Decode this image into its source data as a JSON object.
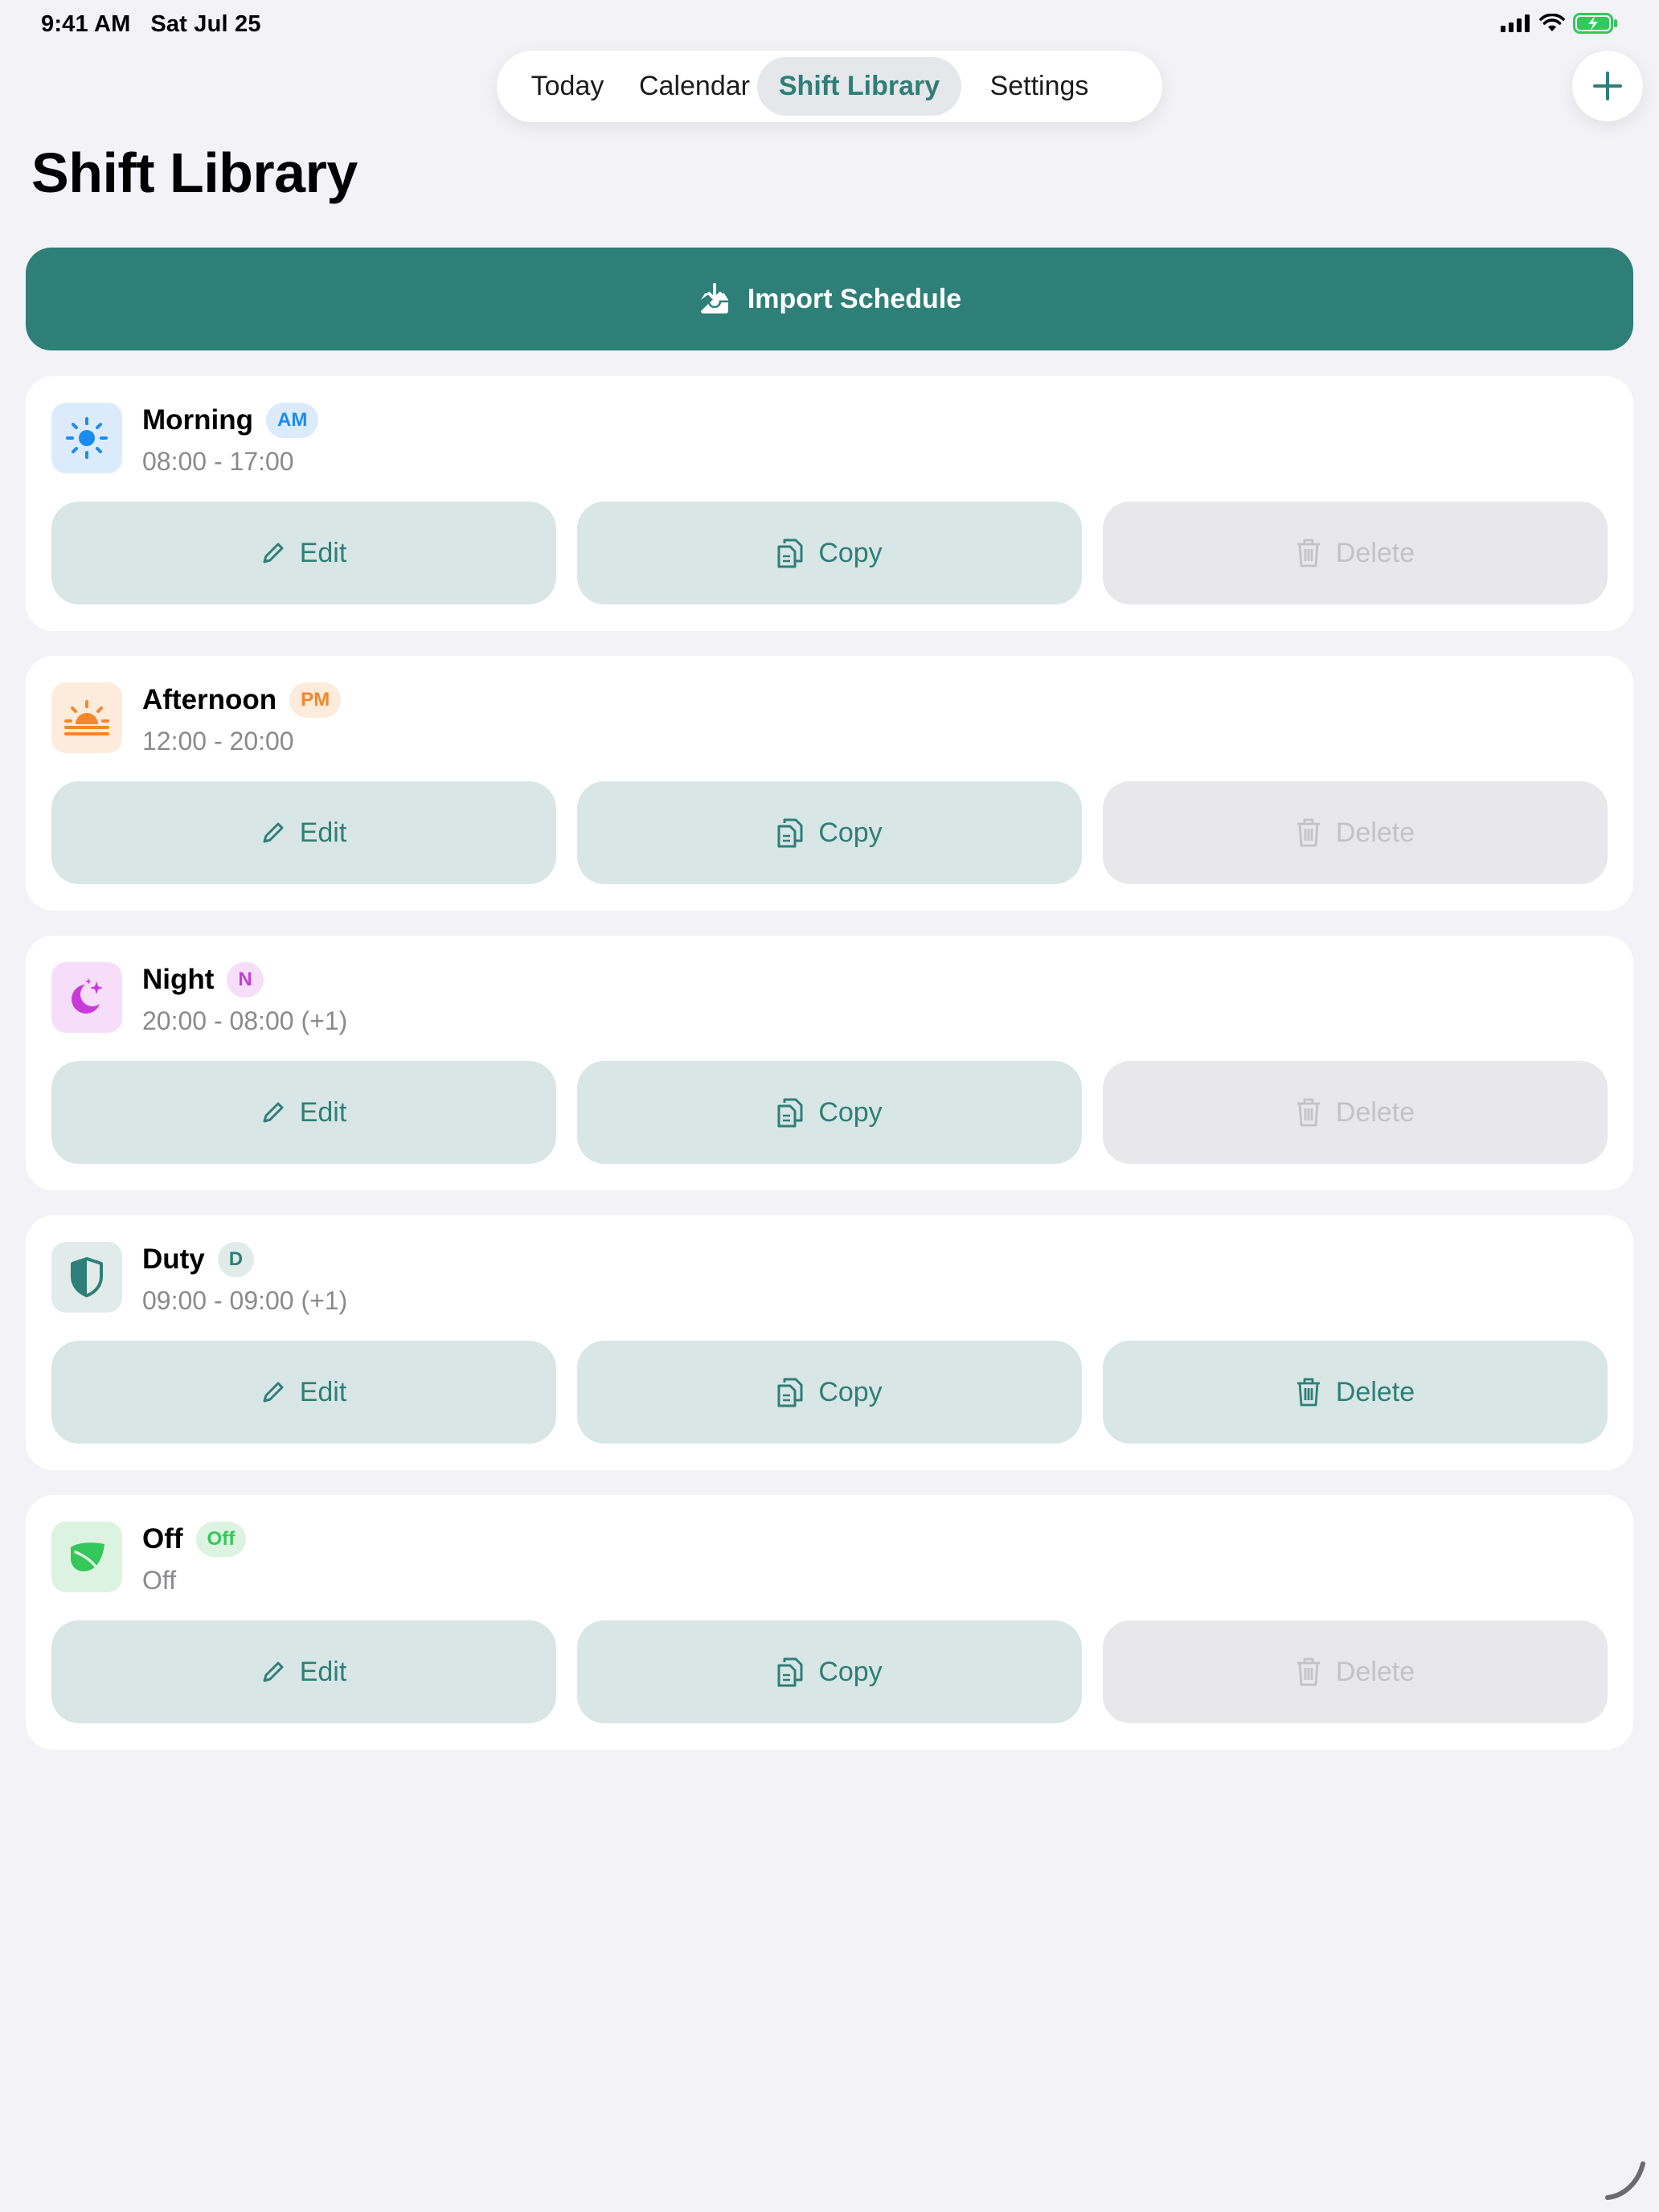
{
  "status_bar": {
    "time": "9:41 AM",
    "date": "Sat Jul 25"
  },
  "tabs": [
    {
      "label": "Today",
      "active": false
    },
    {
      "label": "Calendar",
      "active": false
    },
    {
      "label": "Shift Library",
      "active": true
    },
    {
      "label": "Settings",
      "active": false
    }
  ],
  "add_icon": "plus-icon",
  "page_title": "Shift Library",
  "import_button": {
    "label": "Import Schedule",
    "icon": "tray-download-icon"
  },
  "actions": {
    "edit": "Edit",
    "copy": "Copy",
    "delete": "Delete"
  },
  "shifts": [
    {
      "name": "Morning",
      "badge": "AM",
      "time": "08:00 - 17:00",
      "icon": "sun-icon",
      "icon_bg": "#dcebfb",
      "icon_color": "#1a8cf0",
      "badge_bg": "#dcebfb",
      "badge_color": "#1a8cf0",
      "delete_enabled": false
    },
    {
      "name": "Afternoon",
      "badge": "PM",
      "time": "12:00 - 20:00",
      "icon": "sunset-icon",
      "icon_bg": "#fdebdc",
      "icon_color": "#f5862a",
      "badge_bg": "#fdebdc",
      "badge_color": "#f5862a",
      "delete_enabled": false
    },
    {
      "name": "Night",
      "badge": "N",
      "time": "20:00 - 08:00 (+1)",
      "icon": "moon-stars-icon",
      "icon_bg": "#f6def8",
      "icon_color": "#c93bd9",
      "badge_bg": "#f6def8",
      "badge_color": "#c93bd9",
      "delete_enabled": false
    },
    {
      "name": "Duty",
      "badge": "D",
      "time": "09:00 - 09:00 (+1)",
      "icon": "shield-icon",
      "icon_bg": "#e0ebea",
      "icon_color": "#2e7f78",
      "badge_bg": "#e0ebea",
      "badge_color": "#2e7f78",
      "delete_enabled": true
    },
    {
      "name": "Off",
      "badge": "Off",
      "time": "Off",
      "icon": "leaf-icon",
      "icon_bg": "#ddf3e2",
      "icon_color": "#34c759",
      "badge_bg": "#ddf3e2",
      "badge_color": "#34c759",
      "delete_enabled": false
    }
  ],
  "colors": {
    "accent": "#2e7f78",
    "background": "#f2f2f7"
  }
}
